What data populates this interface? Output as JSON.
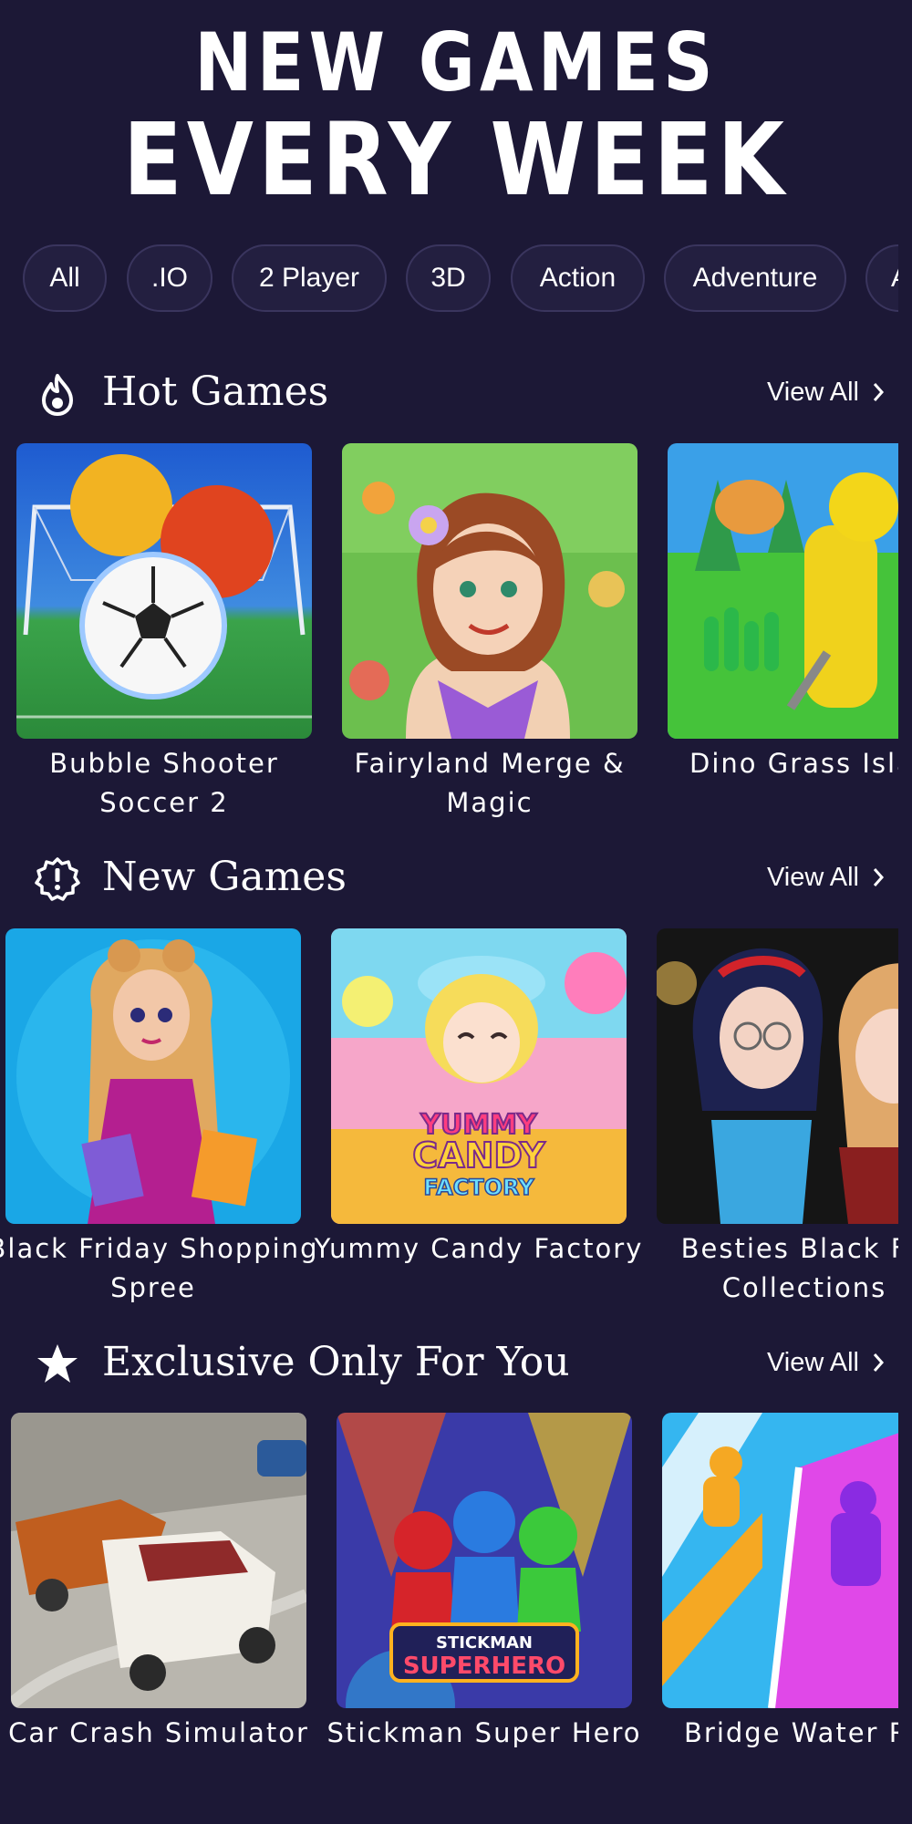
{
  "hero": {
    "line1": "NEW GAMES",
    "line2": "EVERY WEEK"
  },
  "categories": [
    "All",
    ".IO",
    "2 Player",
    "3D",
    "Action",
    "Adventure",
    "A"
  ],
  "sections": [
    {
      "title": "Hot Games",
      "icon": "flame-icon",
      "view_all": "View All",
      "games": [
        "Bubble Shooter Soccer 2",
        "Fairyland Merge & Magic",
        "Dino Grass Isla"
      ]
    },
    {
      "title": "New Games",
      "icon": "alert-badge-icon",
      "view_all": "View All",
      "games": [
        "Black Friday Shopping Spree",
        "Yummy Candy Factory",
        "Besties Black Fri Collections"
      ]
    },
    {
      "title": "Exclusive Only For You",
      "icon": "star-icon",
      "view_all": "View All",
      "games": [
        "Car Crash Simulator",
        "Stickman Super Hero",
        "Bridge Water Ru"
      ]
    }
  ],
  "thumbnail_text": {
    "candy_logo": [
      "YUMMY",
      "CANDY",
      "FACTORY"
    ],
    "stickman_logo": [
      "STICKMAN",
      "SUPERHERO"
    ]
  },
  "colors": {
    "background": "#1c1836",
    "chip_border": "#3a355e",
    "text": "#ffffff"
  }
}
